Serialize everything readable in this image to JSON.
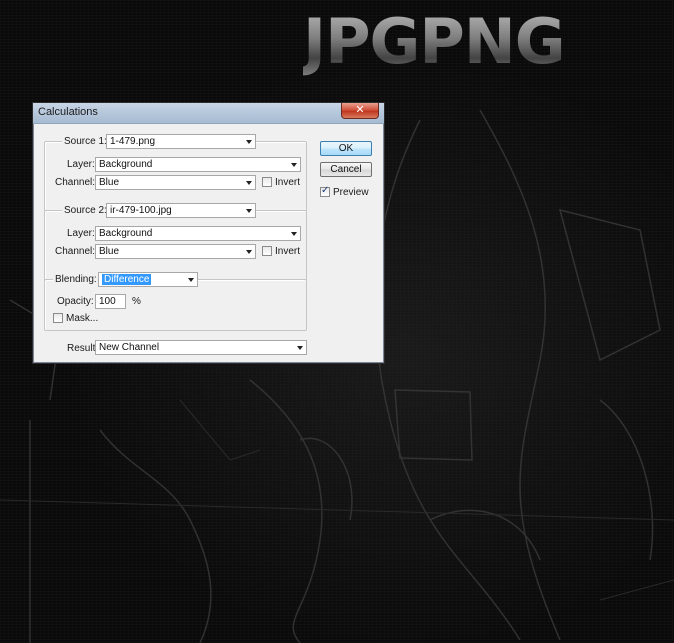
{
  "background": {
    "logo_text": "JPGPNG"
  },
  "dialog": {
    "title": "Calculations",
    "close_label": "✕",
    "source1": {
      "label": "Source 1:",
      "file": "1-479.png",
      "layer_label": "Layer:",
      "layer": "Background",
      "channel_label": "Channel:",
      "channel": "Blue",
      "invert_label": "Invert",
      "invert_checked": false
    },
    "source2": {
      "label": "Source 2:",
      "file": "ir-479-100.jpg",
      "layer_label": "Layer:",
      "layer": "Background",
      "channel_label": "Channel:",
      "channel": "Blue",
      "invert_label": "Invert",
      "invert_checked": false
    },
    "blending": {
      "label": "Blending:",
      "mode": "Difference",
      "opacity_label": "Opacity:",
      "opacity": "100",
      "opacity_unit": "%",
      "mask_label": "Mask...",
      "mask_checked": false
    },
    "result": {
      "label": "Result:",
      "value": "New Channel"
    },
    "buttons": {
      "ok": "OK",
      "cancel": "Cancel",
      "preview_label": "Preview",
      "preview_checked": true
    }
  }
}
